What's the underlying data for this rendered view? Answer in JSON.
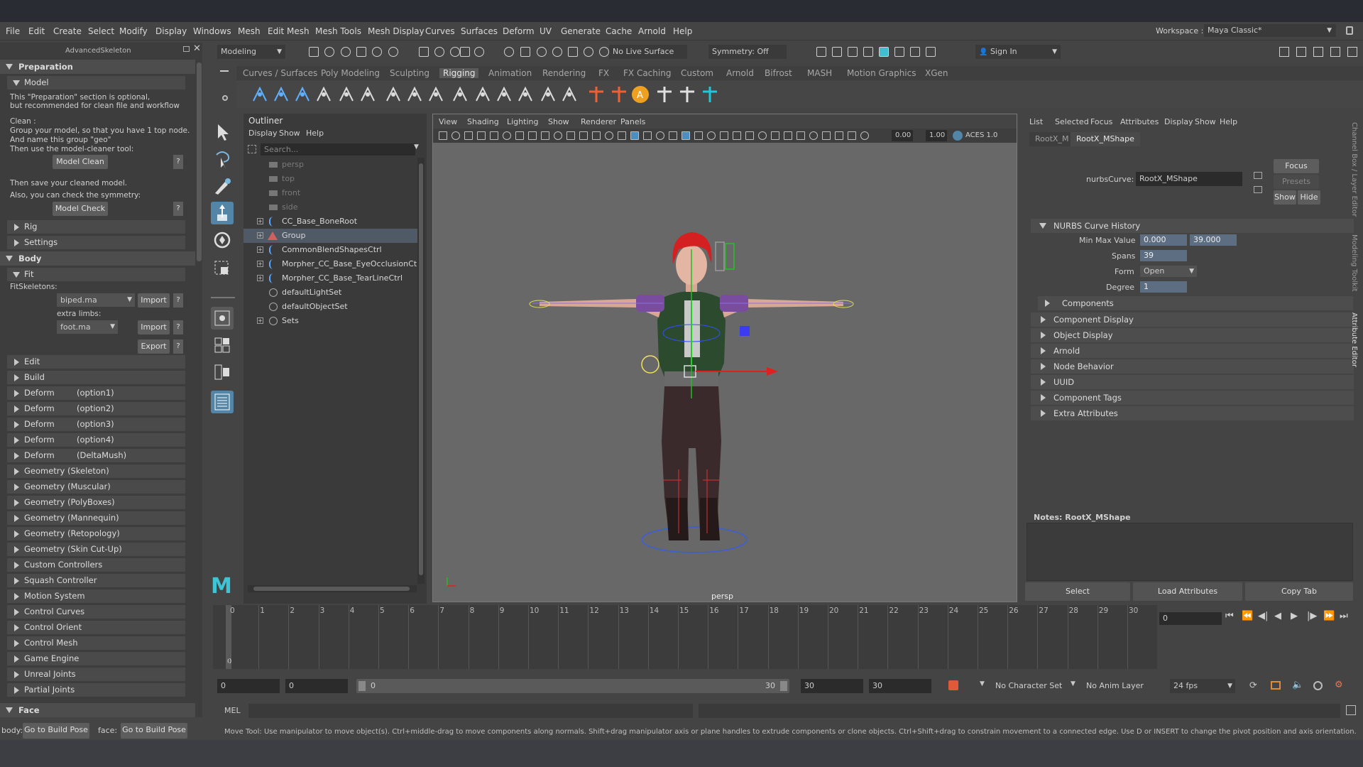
{
  "menubar": {
    "items": [
      "File",
      "Edit",
      "Create",
      "Select",
      "Modify",
      "Display",
      "Windows",
      "Mesh",
      "Edit Mesh",
      "Mesh Tools",
      "Mesh Display",
      "Curves",
      "Surfaces",
      "Deform",
      "UV",
      "Generate",
      "Cache",
      "Arnold",
      "Help"
    ],
    "workspace_label": "Workspace :",
    "workspace_value": "Maya Classic*"
  },
  "statusline": {
    "mode": "Modeling",
    "live_surface": "No Live Surface",
    "symmetry": "Symmetry: Off",
    "sign_in": "Sign In"
  },
  "shelf": {
    "tabs": [
      "Curves / Surfaces",
      "Poly Modeling",
      "Sculpting",
      "Rigging",
      "Animation",
      "Rendering",
      "FX",
      "FX Caching",
      "Custom",
      "Arnold",
      "Bifrost",
      "MASH",
      "Motion Graphics",
      "XGen"
    ],
    "active_tab": "Rigging"
  },
  "advanced_skeleton": {
    "title": "AdvancedSkeleton",
    "preparation": "Preparation",
    "model": "Model",
    "model_note_1": "This \"Preparation\" section is optional,",
    "model_note_2": "but recommended for clean file and workflow",
    "clean_label": "Clean :",
    "clean_text_1": "Group your model, so that you have 1 top node.",
    "clean_text_2": "And name this group \"geo\"",
    "clean_text_3": "Then use the model-cleaner tool:",
    "model_clean_btn": "Model Clean",
    "save_text": "Then save your cleaned model.",
    "symmetry_text": "Also, you can check the symmetry:",
    "model_check_btn": "Model Check",
    "help_btn": "?",
    "rig": "Rig",
    "settings": "Settings",
    "body": "Body",
    "fit": "Fit",
    "fit_skeletons_label": "FitSkeletons:",
    "fit_skeleton_value": "biped.ma",
    "import_btn": "Import",
    "extra_limbs_label": "extra limbs:",
    "extra_limbs_value": "foot.ma",
    "export_btn": "Export",
    "sections": [
      {
        "name": "Edit",
        "opt": ""
      },
      {
        "name": "Build",
        "opt": ""
      },
      {
        "name": "Deform",
        "opt": "(option1)"
      },
      {
        "name": "Deform",
        "opt": "(option2)"
      },
      {
        "name": "Deform",
        "opt": "(option3)"
      },
      {
        "name": "Deform",
        "opt": "(option4)"
      },
      {
        "name": "Deform",
        "opt": "(DeltaMush)"
      },
      {
        "name": "Geometry (Skeleton)",
        "opt": ""
      },
      {
        "name": "Geometry (Muscular)",
        "opt": ""
      },
      {
        "name": "Geometry (PolyBoxes)",
        "opt": ""
      },
      {
        "name": "Geometry (Mannequin)",
        "opt": ""
      },
      {
        "name": "Geometry (Retopology)",
        "opt": ""
      },
      {
        "name": "Geometry (Skin Cut-Up)",
        "opt": ""
      },
      {
        "name": "Custom Controllers",
        "opt": ""
      },
      {
        "name": "Squash Controller",
        "opt": ""
      },
      {
        "name": "Motion System",
        "opt": ""
      },
      {
        "name": "Control Curves",
        "opt": ""
      },
      {
        "name": "Control Orient",
        "opt": ""
      },
      {
        "name": "Control Mesh",
        "opt": ""
      },
      {
        "name": "Game Engine",
        "opt": ""
      },
      {
        "name": "Unreal Joints",
        "opt": ""
      },
      {
        "name": "Partial Joints",
        "opt": ""
      }
    ],
    "face": "Face",
    "body_label": "body:",
    "face_label": "face:",
    "build_pose_btn": "Go to Build Pose"
  },
  "outliner": {
    "title": "Outliner",
    "menu": [
      "Display",
      "Show",
      "Help"
    ],
    "search_placeholder": "Search...",
    "items": [
      {
        "label": "persp",
        "dim": true,
        "type": "camera",
        "expand": false
      },
      {
        "label": "top",
        "dim": true,
        "type": "camera",
        "expand": false
      },
      {
        "label": "front",
        "dim": true,
        "type": "camera",
        "expand": false
      },
      {
        "label": "side",
        "dim": true,
        "type": "camera",
        "expand": false
      },
      {
        "label": "CC_Base_BoneRoot",
        "dim": false,
        "type": "curve",
        "expand": true
      },
      {
        "label": "Group",
        "dim": false,
        "type": "group",
        "expand": true,
        "selected": true
      },
      {
        "label": "CommonBlendShapesCtrl",
        "dim": false,
        "type": "curve",
        "expand": true
      },
      {
        "label": "Morpher_CC_Base_EyeOcclusionCtrl",
        "dim": false,
        "type": "curve",
        "expand": true
      },
      {
        "label": "Morpher_CC_Base_TearLineCtrl",
        "dim": false,
        "type": "curve",
        "expand": true
      },
      {
        "label": "defaultLightSet",
        "dim": false,
        "type": "set",
        "expand": false
      },
      {
        "label": "defaultObjectSet",
        "dim": false,
        "type": "set",
        "expand": false
      },
      {
        "label": "Sets",
        "dim": false,
        "type": "set",
        "expand": true
      }
    ]
  },
  "viewport": {
    "menu": [
      "View",
      "Shading",
      "Lighting",
      "Show",
      "Renderer",
      "Panels"
    ],
    "exposure": "0.00",
    "gamma": "1.00",
    "color_space": "ACES 1.0",
    "camera": "persp"
  },
  "attribute_editor": {
    "menu": [
      "List",
      "Selected",
      "Focus",
      "Attributes",
      "Display",
      "Show",
      "Help"
    ],
    "tabs": [
      "RootX_M",
      "RootX_MShape"
    ],
    "active_tab": "RootX_MShape",
    "node_type_label": "nurbsCurve:",
    "node_name": "RootX_MShape",
    "focus_btn": "Focus",
    "presets_btn": "Presets",
    "show_btn": "Show",
    "hide_btn": "Hide",
    "history_section": "NURBS Curve History",
    "min_max_label": "Min Max Value",
    "min_value": "0.000",
    "max_value": "39.000",
    "spans_label": "Spans",
    "spans_value": "39",
    "form_label": "Form",
    "form_value": "Open",
    "degree_label": "Degree",
    "degree_value": "1",
    "components": "Components",
    "sections": [
      "Component Display",
      "Object Display",
      "Arnold",
      "Node Behavior",
      "UUID",
      "Component Tags",
      "Extra Attributes"
    ],
    "notes_label": "Notes:  RootX_MShape",
    "select_btn": "Select",
    "load_btn": "Load Attributes",
    "copy_btn": "Copy Tab"
  },
  "side_tabs": [
    "Channel Box / Layer Editor",
    "Modeling Toolkit",
    "Attribute Editor"
  ],
  "timeline": {
    "frames": [
      "0",
      "1",
      "2",
      "3",
      "4",
      "5",
      "6",
      "7",
      "8",
      "9",
      "10",
      "11",
      "12",
      "13",
      "14",
      "15",
      "16",
      "17",
      "18",
      "19",
      "20",
      "21",
      "22",
      "23",
      "24",
      "25",
      "26",
      "27",
      "28",
      "29",
      "30"
    ],
    "current_frame": "0",
    "current_frame_field": "0"
  },
  "range": {
    "start": "0",
    "anim_start": "0",
    "slider_start": "0",
    "slider_end": "30",
    "anim_end": "30",
    "end": "30",
    "character_set": "No Character Set",
    "anim_layer": "No Anim Layer",
    "fps": "24 fps"
  },
  "command": {
    "lang": "MEL"
  },
  "help_line": "Move Tool: Use manipulator to move object(s). Ctrl+middle-drag to move components along normals. Shift+drag manipulator axis or plane handles to extrude components or clone objects. Ctrl+Shift+drag to constrain movement to a connected edge. Use D or INSERT to change the pivot position and axis orientation.",
  "colors": {
    "accent_blue": "#5285a6",
    "rig_cyan": "#1ec8d8",
    "rig_orange": "#f0a020"
  }
}
